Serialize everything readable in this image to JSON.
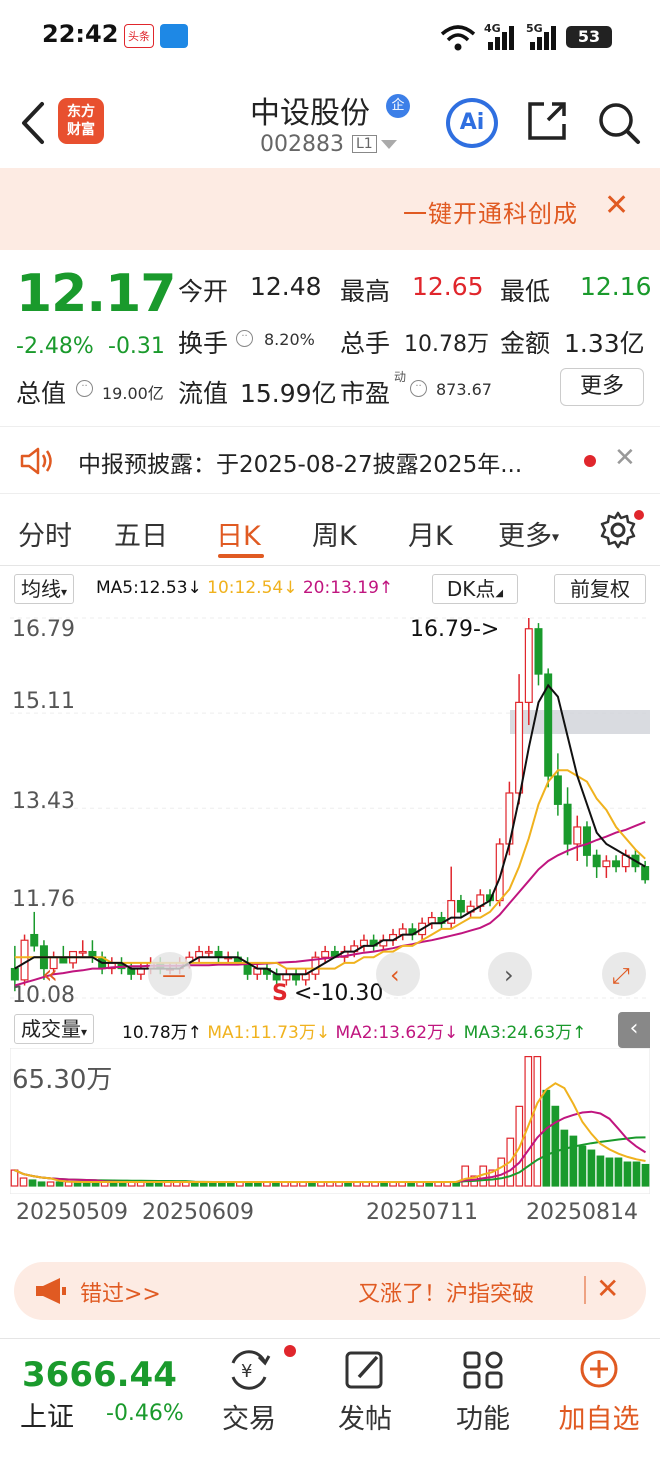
{
  "status_bar": {
    "time": "22:42",
    "badge1": "头条",
    "battery": "53",
    "net1": "4G",
    "net2": "5G"
  },
  "header": {
    "stock_name": "中设股份",
    "name_badge": "企",
    "stock_code": "002883",
    "code_badge": "L1",
    "logo_line1": "东方",
    "logo_line2": "财富",
    "ai_label": "Ai"
  },
  "promo": {
    "text": "一键开通科创成"
  },
  "quote": {
    "price": "12.17",
    "change_pct": "-2.48%",
    "change_amt": "-0.31",
    "open_label": "今开",
    "open": "12.48",
    "high_label": "最高",
    "high": "12.65",
    "low_label": "最低",
    "low": "12.16",
    "turnover_label": "换手",
    "turnover": "8.20%",
    "volume_label": "总手",
    "volume": "10.78万",
    "amount_label": "金额",
    "amount": "1.33亿",
    "mcap_label": "总值",
    "mcap": "19.00亿",
    "float_label": "流值",
    "float_cap": "15.99亿",
    "pe_label": "市盈",
    "pe_sup": "动",
    "pe": "873.67",
    "more_label": "更多"
  },
  "notice": {
    "text": "中报预披露：于2025-08-27披露2025年..."
  },
  "tabs": [
    "分时",
    "五日",
    "日K",
    "周K",
    "月K",
    "更多"
  ],
  "active_tab": "日K",
  "chart_toolbar": {
    "ma_select": "均线",
    "ma5": "MA5:12.53↓",
    "ma10": "10:12.54↓",
    "ma20": "20:13.19↑",
    "dk_label": "DK点",
    "adjust_label": "前复权"
  },
  "kline": {
    "y_labels": [
      "16.79",
      "15.11",
      "13.43",
      "11.76",
      "10.08"
    ],
    "max_annotation": "16.79->",
    "min_annotation": "<-10.30",
    "s_marker": "S"
  },
  "volume": {
    "select_label": "成交量",
    "vol": "10.78万↑",
    "ma1": "MA1:11.73万↓",
    "ma2": "MA2:13.62万↓",
    "ma3": "MA3:24.63万↑",
    "y_max_label": "65.30万"
  },
  "dates": [
    "20250509",
    "20250609",
    "20250711",
    "20250814"
  ],
  "ad": {
    "left": "错过>>",
    "right": "又涨了！沪指突破"
  },
  "bottom": {
    "index_value": "3666.44",
    "index_name": "上证",
    "index_change": "-0.46%",
    "nav": [
      "交易",
      "发帖",
      "功能",
      "加自选"
    ]
  },
  "colors": {
    "up": "#e0262c",
    "down": "#1a9a2c",
    "accent": "#e05a22",
    "ma5": "#111111",
    "ma10": "#f0b21e",
    "ma20": "#c0157f"
  },
  "chart_data": {
    "type": "candlestick",
    "ylim": [
      10.08,
      16.79
    ],
    "candles": [
      [
        10.6,
        11.0,
        10.2,
        10.4
      ],
      [
        10.4,
        11.2,
        10.3,
        11.1
      ],
      [
        11.2,
        11.6,
        10.9,
        11.0
      ],
      [
        11.0,
        11.1,
        10.4,
        10.6
      ],
      [
        10.6,
        10.9,
        10.5,
        10.8
      ],
      [
        10.8,
        11.0,
        10.7,
        10.7
      ],
      [
        10.7,
        10.9,
        10.6,
        10.9
      ],
      [
        10.9,
        11.1,
        10.8,
        10.9
      ],
      [
        10.9,
        11.1,
        10.7,
        10.8
      ],
      [
        10.8,
        10.9,
        10.5,
        10.6
      ],
      [
        10.6,
        10.8,
        10.5,
        10.7
      ],
      [
        10.7,
        10.8,
        10.5,
        10.6
      ],
      [
        10.6,
        10.7,
        10.4,
        10.5
      ],
      [
        10.5,
        10.7,
        10.4,
        10.6
      ],
      [
        10.6,
        10.8,
        10.5,
        10.7
      ],
      [
        10.7,
        10.8,
        10.5,
        10.6
      ],
      [
        10.6,
        10.7,
        10.5,
        10.6
      ],
      [
        10.6,
        10.8,
        10.5,
        10.7
      ],
      [
        10.7,
        10.9,
        10.6,
        10.8
      ],
      [
        10.8,
        11.0,
        10.7,
        10.9
      ],
      [
        10.9,
        11.0,
        10.8,
        10.9
      ],
      [
        10.9,
        11.0,
        10.7,
        10.8
      ],
      [
        10.8,
        10.9,
        10.7,
        10.8
      ],
      [
        10.8,
        10.9,
        10.7,
        10.7
      ],
      [
        10.7,
        10.8,
        10.4,
        10.5
      ],
      [
        10.5,
        10.7,
        10.4,
        10.6
      ],
      [
        10.6,
        10.7,
        10.4,
        10.5
      ],
      [
        10.5,
        10.6,
        10.3,
        10.4
      ],
      [
        10.4,
        10.6,
        10.3,
        10.5
      ],
      [
        10.5,
        10.6,
        10.3,
        10.4
      ],
      [
        10.4,
        10.6,
        10.3,
        10.5
      ],
      [
        10.5,
        10.9,
        10.4,
        10.8
      ],
      [
        10.8,
        11.0,
        10.7,
        10.9
      ],
      [
        10.9,
        11.0,
        10.8,
        10.8
      ],
      [
        10.8,
        11.0,
        10.7,
        10.9
      ],
      [
        10.9,
        11.1,
        10.8,
        11.0
      ],
      [
        11.0,
        11.2,
        10.9,
        11.1
      ],
      [
        11.1,
        11.2,
        10.9,
        11.0
      ],
      [
        11.0,
        11.2,
        10.9,
        11.1
      ],
      [
        11.1,
        11.3,
        11.0,
        11.2
      ],
      [
        11.2,
        11.4,
        11.1,
        11.3
      ],
      [
        11.3,
        11.4,
        11.1,
        11.2
      ],
      [
        11.2,
        11.5,
        11.1,
        11.4
      ],
      [
        11.4,
        11.6,
        11.3,
        11.5
      ],
      [
        11.5,
        11.6,
        11.3,
        11.4
      ],
      [
        11.4,
        12.4,
        11.3,
        11.8
      ],
      [
        11.8,
        11.9,
        11.5,
        11.6
      ],
      [
        11.6,
        11.8,
        11.5,
        11.7
      ],
      [
        11.7,
        12.0,
        11.6,
        11.9
      ],
      [
        11.9,
        12.0,
        11.7,
        11.8
      ],
      [
        11.8,
        12.9,
        11.7,
        12.8
      ],
      [
        12.8,
        13.9,
        12.6,
        13.7
      ],
      [
        13.7,
        15.8,
        13.5,
        15.3
      ],
      [
        15.3,
        16.79,
        14.9,
        16.6
      ],
      [
        16.6,
        16.7,
        15.6,
        15.8
      ],
      [
        15.8,
        15.9,
        13.8,
        14.0
      ],
      [
        14.0,
        14.4,
        13.3,
        13.5
      ],
      [
        13.5,
        13.8,
        12.6,
        12.8
      ],
      [
        12.8,
        13.3,
        12.5,
        13.1
      ],
      [
        13.1,
        13.2,
        12.4,
        12.6
      ],
      [
        12.6,
        12.7,
        12.2,
        12.4
      ],
      [
        12.4,
        12.6,
        12.2,
        12.5
      ],
      [
        12.5,
        12.6,
        12.3,
        12.4
      ],
      [
        12.4,
        12.7,
        12.3,
        12.6
      ],
      [
        12.6,
        12.7,
        12.3,
        12.4
      ],
      [
        12.4,
        12.5,
        12.1,
        12.17
      ]
    ],
    "ma5": [
      10.6,
      10.7,
      10.8,
      10.8,
      10.8,
      10.8,
      10.8,
      10.8,
      10.8,
      10.7,
      10.7,
      10.7,
      10.6,
      10.6,
      10.6,
      10.6,
      10.6,
      10.6,
      10.7,
      10.8,
      10.8,
      10.8,
      10.8,
      10.8,
      10.7,
      10.6,
      10.6,
      10.5,
      10.5,
      10.5,
      10.5,
      10.6,
      10.7,
      10.8,
      10.9,
      10.9,
      11.0,
      11.0,
      11.1,
      11.1,
      11.2,
      11.2,
      11.3,
      11.4,
      11.4,
      11.5,
      11.5,
      11.6,
      11.7,
      11.8,
      12.2,
      12.8,
      13.6,
      14.5,
      15.3,
      15.6,
      15.4,
      14.7,
      14.0,
      13.5,
      13.0,
      12.8,
      12.7,
      12.6,
      12.5,
      12.4
    ],
    "ma10": [
      10.8,
      10.8,
      10.8,
      10.8,
      10.8,
      10.8,
      10.8,
      10.8,
      10.8,
      10.8,
      10.7,
      10.7,
      10.7,
      10.7,
      10.7,
      10.7,
      10.7,
      10.7,
      10.7,
      10.7,
      10.7,
      10.7,
      10.7,
      10.7,
      10.7,
      10.7,
      10.7,
      10.7,
      10.6,
      10.6,
      10.6,
      10.6,
      10.6,
      10.6,
      10.7,
      10.7,
      10.8,
      10.8,
      10.9,
      10.9,
      11.0,
      11.0,
      11.1,
      11.2,
      11.3,
      11.3,
      11.4,
      11.5,
      11.5,
      11.6,
      11.8,
      12.0,
      12.4,
      12.9,
      13.5,
      13.9,
      14.1,
      14.1,
      14.0,
      13.9,
      13.6,
      13.4,
      13.1,
      12.9,
      12.7,
      12.54
    ],
    "ma20": [
      10.3,
      10.35,
      10.4,
      10.45,
      10.5,
      10.52,
      10.55,
      10.57,
      10.6,
      10.6,
      10.62,
      10.63,
      10.64,
      10.64,
      10.65,
      10.65,
      10.65,
      10.65,
      10.66,
      10.66,
      10.66,
      10.67,
      10.67,
      10.67,
      10.68,
      10.68,
      10.69,
      10.7,
      10.71,
      10.72,
      10.74,
      10.76,
      10.78,
      10.8,
      10.82,
      10.85,
      10.88,
      10.9,
      10.93,
      10.96,
      11.0,
      11.03,
      11.07,
      11.1,
      11.14,
      11.18,
      11.22,
      11.27,
      11.32,
      11.4,
      11.55,
      11.75,
      11.95,
      12.15,
      12.35,
      12.5,
      12.6,
      12.68,
      12.75,
      12.8,
      12.87,
      12.93,
      13.0,
      13.05,
      13.12,
      13.19
    ],
    "volumes": [
      8,
      4,
      3,
      2,
      2,
      2,
      2,
      2,
      2,
      2,
      2,
      2,
      2,
      2,
      2,
      2,
      2,
      2,
      2,
      2,
      2,
      2,
      2,
      2,
      2,
      2,
      2,
      2,
      2,
      2,
      2,
      2,
      2,
      2,
      2,
      2,
      2,
      2,
      2,
      2,
      2,
      2,
      2,
      2,
      2,
      2,
      2,
      2,
      2,
      2,
      10,
      5,
      10,
      8,
      14,
      24,
      40,
      65,
      65,
      48,
      40,
      28,
      25,
      20,
      18,
      15,
      14,
      14,
      12,
      12,
      10.78
    ],
    "volume_up": [
      1,
      1,
      0,
      0,
      1,
      0,
      1,
      0,
      0,
      0,
      1,
      0,
      0,
      1,
      1,
      0,
      0,
      1,
      1,
      1,
      0,
      0,
      0,
      0,
      0,
      1,
      0,
      0,
      1,
      0,
      1,
      1,
      1,
      0,
      1,
      1,
      1,
      0,
      1,
      1,
      1,
      0,
      1,
      1,
      0,
      1,
      0,
      1,
      1,
      0,
      1,
      1,
      1,
      1,
      1,
      1,
      1,
      1,
      1,
      0,
      0,
      0,
      0,
      0,
      0,
      0,
      0,
      0,
      0,
      0,
      0
    ]
  }
}
